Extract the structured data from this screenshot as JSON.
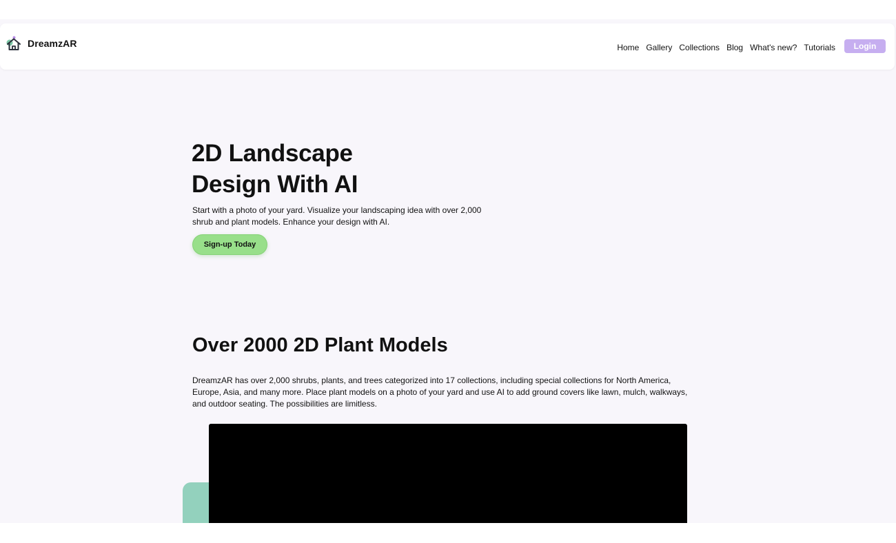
{
  "brand": {
    "name": "DreamzAR",
    "logo_icon": "house-logo-icon",
    "colors": {
      "house": "#2a2f3a",
      "leaf": "#7bc7a6",
      "dot": "#b78be6"
    }
  },
  "nav": {
    "links": [
      "Home",
      "Gallery",
      "Collections",
      "Blog",
      "What's new?",
      "Tutorials"
    ],
    "login_label": "Login"
  },
  "hero": {
    "title_line1": "2D Landscape",
    "title_line2": "Design With AI",
    "description": "Start with a photo of your yard. Visualize your landscaping idea with over 2,000 shrub and plant models. Enhance your design with AI.",
    "cta_label": "Sign-up Today"
  },
  "models_section": {
    "title": "Over 2000 2D Plant Models",
    "description": "DreamzAR has over 2,000 shrubs, plants, and trees categorized into 17 collections, including special collections for North America, Europe, Asia, and many more. Place plant models on a photo of your yard and use AI to add ground covers like lawn, mulch, walkways, and outdoor seating. The possibilities are limitless."
  },
  "colors": {
    "page_background": "#f8f6fb",
    "login_button": "#c6aef0",
    "cta_button": "#98df8a",
    "accent_shape": "#93d1bd",
    "video_frame": "#000000"
  }
}
